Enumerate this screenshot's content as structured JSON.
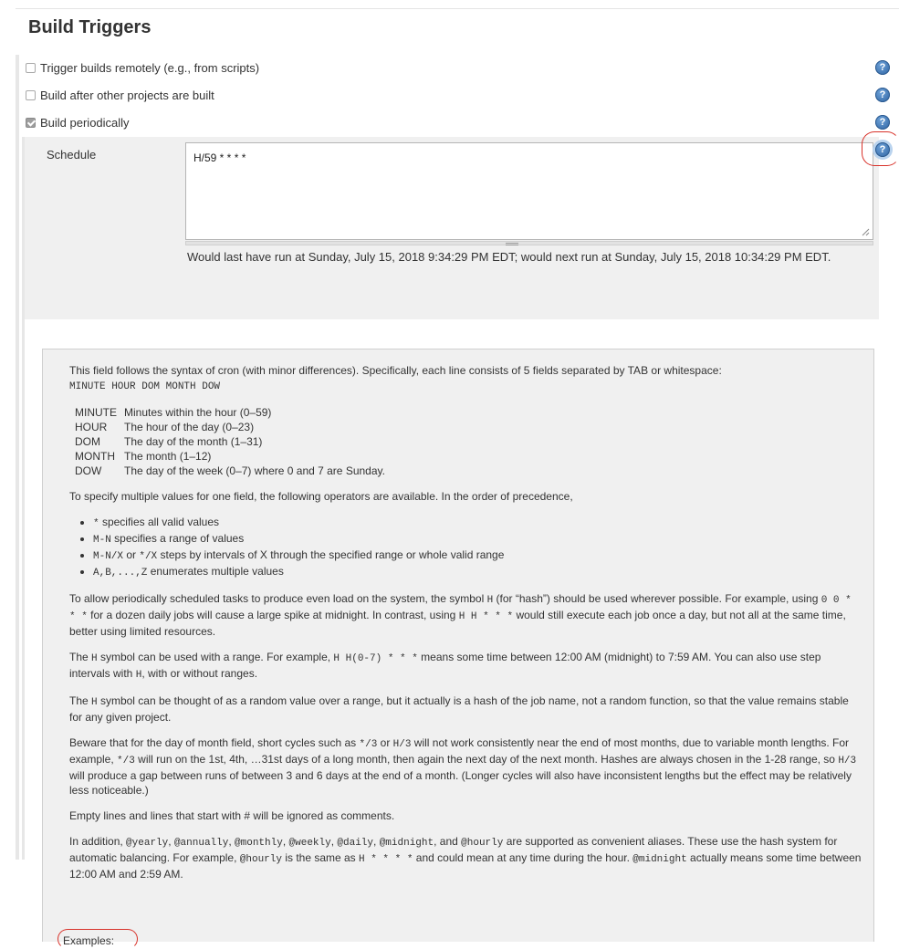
{
  "section": {
    "title": "Build Triggers"
  },
  "triggers": [
    {
      "label": "Trigger builds remotely (e.g., from scripts)",
      "checked": false,
      "help_icon": "question-circle-icon"
    },
    {
      "label": "Build after other projects are built",
      "checked": false,
      "help_icon": "question-circle-icon"
    },
    {
      "label": "Build periodically",
      "checked": true,
      "help_icon": "question-circle-icon"
    }
  ],
  "schedule": {
    "label": "Schedule",
    "value": "H/59 * * * *",
    "next_run": "Would last have run at Sunday, July 15, 2018 9:34:29 PM EDT; would next run at Sunday, July 15, 2018 10:34:29 PM EDT.",
    "help_icon": "question-circle-icon"
  },
  "help": {
    "intro": "This field follows the syntax of cron (with minor differences). Specifically, each line consists of 5 fields separated by TAB or whitespace:",
    "format_line": "MINUTE HOUR DOM MONTH DOW",
    "fields": [
      {
        "key": "MINUTE",
        "desc": "Minutes within the hour (0–59)"
      },
      {
        "key": "HOUR",
        "desc": "The hour of the day (0–23)"
      },
      {
        "key": "DOM",
        "desc": "The day of the month (1–31)"
      },
      {
        "key": "MONTH",
        "desc": "The month (1–12)"
      },
      {
        "key": "DOW",
        "desc": "The day of the week (0–7) where 0 and 7 are Sunday."
      }
    ],
    "operators_intro": "To specify multiple values for one field, the following operators are available. In the order of precedence,",
    "operators": [
      {
        "code": "*",
        "text": " specifies all valid values"
      },
      {
        "code": "M-N",
        "text": " specifies a range of values"
      },
      {
        "code": "M-N/X",
        "mid": " or ",
        "code2": "*/X",
        "text": " steps by intervals of X through the specified range or whole valid range"
      },
      {
        "code": "A,B,...,Z",
        "text": " enumerates multiple values"
      }
    ],
    "hash_p": {
      "a": "To allow periodically scheduled tasks to produce even load on the system, the symbol ",
      "c1": "H",
      "b": " (for “hash”) should be used wherever possible. For example, using ",
      "c2": "0 0 * * *",
      "c": " for a dozen daily jobs will cause a large spike at midnight. In contrast, using ",
      "c3": "H H * * *",
      "d": " would still execute each job once a day, but not all at the same time, better using limited resources."
    },
    "range_p": {
      "a": "The ",
      "c1": "H",
      "b": " symbol can be used with a range. For example, ",
      "c2": "H H(0-7) * * *",
      "c": " means some time between 12:00 AM (midnight) to 7:59 AM. You can also use step intervals with ",
      "c3": "H",
      "d": ", with or without ranges."
    },
    "random_p": {
      "a": "The ",
      "c1": "H",
      "b": " symbol can be thought of as a random value over a range, but it actually is a hash of the job name, not a random function, so that the value remains stable for any given project."
    },
    "beware_p": {
      "a": "Beware that for the day of month field, short cycles such as ",
      "c1": "*/3",
      "b": " or ",
      "c2": "H/3",
      "c": " will not work consistently near the end of most months, due to variable month lengths. For example, ",
      "c3": "*/3",
      "d": " will run on the 1st, 4th, …31st days of a long month, then again the next day of the next month. Hashes are always chosen in the 1-28 range, so ",
      "c4": "H/3",
      "e": " will produce a gap between runs of between 3 and 6 days at the end of a month. (Longer cycles will also have inconsistent lengths but the effect may be relatively less noticeable.)"
    },
    "comments_p": "Empty lines and lines that start with # will be ignored as comments.",
    "aliases_p": {
      "a": "In addition, ",
      "c1": "@yearly",
      "s1": ", ",
      "c2": "@annually",
      "s2": ", ",
      "c3": "@monthly",
      "s3": ", ",
      "c4": "@weekly",
      "s4": ", ",
      "c5": "@daily",
      "s5": ", ",
      "c6": "@midnight",
      "s6": ", and ",
      "c7": "@hourly",
      "b": " are supported as convenient aliases. These use the hash system for automatic balancing. For example, ",
      "c8": "@hourly",
      "c": " is the same as ",
      "c9": "H * * * *",
      "d": " and could mean at any time during the hour. ",
      "c10": "@midnight",
      "e": " actually means some time between 12:00 AM and 2:59 AM."
    },
    "examples_label": "Examples:"
  },
  "colors": {
    "annotation": "#d8322a",
    "help_icon": "#2a5f9e",
    "panel_bg": "#f0f0f0"
  }
}
